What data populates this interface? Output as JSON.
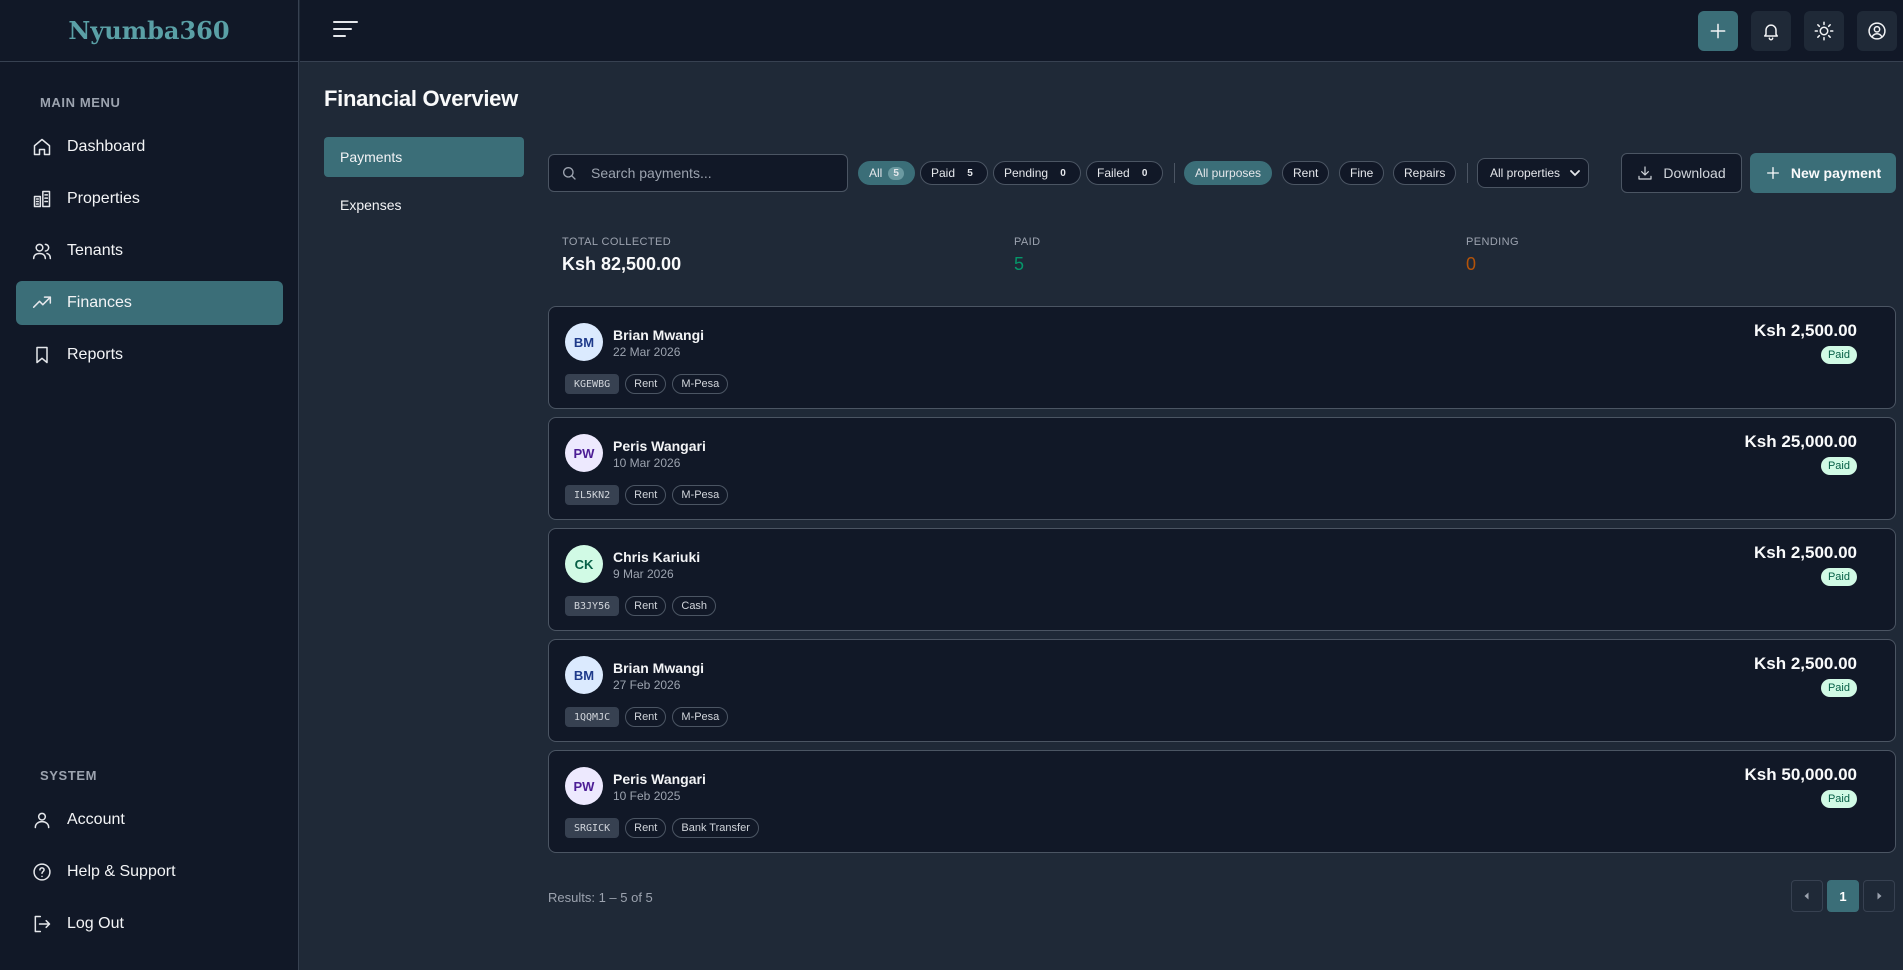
{
  "app": {
    "logo": "Nyumba360"
  },
  "sidebar": {
    "main_menu_label": "MAIN MENU",
    "main_items": [
      {
        "label": "Dashboard",
        "icon": "home-icon"
      },
      {
        "label": "Properties",
        "icon": "building-icon"
      },
      {
        "label": "Tenants",
        "icon": "users-icon"
      },
      {
        "label": "Finances",
        "icon": "trending-up-icon",
        "active": true
      },
      {
        "label": "Reports",
        "icon": "bookmark-icon"
      }
    ],
    "system_label": "SYSTEM",
    "system_items": [
      {
        "label": "Account",
        "icon": "user-icon"
      },
      {
        "label": "Help & Support",
        "icon": "help-circle-icon"
      },
      {
        "label": "Log Out",
        "icon": "logout-icon"
      }
    ]
  },
  "topbar": {
    "icons": [
      "menu-icon",
      "plus-icon",
      "bell-icon",
      "sun-icon",
      "user-circle-icon"
    ]
  },
  "page": {
    "title": "Financial Overview",
    "subnav": [
      {
        "label": "Payments",
        "active": true
      },
      {
        "label": "Expenses",
        "active": false
      }
    ]
  },
  "toolbar": {
    "search_placeholder": "Search payments...",
    "status_filters": [
      {
        "label": "All",
        "count": "5",
        "active": true
      },
      {
        "label": "Paid",
        "count": "5",
        "active": false
      },
      {
        "label": "Pending",
        "count": "0",
        "active": false
      },
      {
        "label": "Failed",
        "count": "0",
        "active": false
      }
    ],
    "purpose_filters": [
      {
        "label": "All purposes",
        "active": true
      },
      {
        "label": "Rent",
        "active": false
      },
      {
        "label": "Fine",
        "active": false
      },
      {
        "label": "Repairs",
        "active": false
      }
    ],
    "property_select": "All properties",
    "download_label": "Download",
    "new_payment_label": "New payment"
  },
  "stats": {
    "total_label": "TOTAL COLLECTED",
    "total_value": "Ksh 82,500.00",
    "paid_label": "PAID",
    "paid_value": "5",
    "pending_label": "PENDING",
    "pending_value": "0",
    "colors": {
      "paid": "#059669",
      "pending": "#b45309"
    }
  },
  "payments": [
    {
      "initials": "BM",
      "name": "Brian Mwangi",
      "date": "22 Mar 2026",
      "code": "KGEWBG",
      "purpose": "Rent",
      "method": "M-Pesa",
      "amount": "Ksh 2,500.00",
      "status": "Paid",
      "avatar_bg": "#dbeafe",
      "avatar_fg": "#1e3a8a"
    },
    {
      "initials": "PW",
      "name": "Peris Wangari",
      "date": "10 Mar 2026",
      "code": "IL5KN2",
      "purpose": "Rent",
      "method": "M-Pesa",
      "amount": "Ksh 25,000.00",
      "status": "Paid",
      "avatar_bg": "#ede9fe",
      "avatar_fg": "#4c1d95"
    },
    {
      "initials": "CK",
      "name": "Chris Kariuki",
      "date": "9 Mar 2026",
      "code": "B3JY56",
      "purpose": "Rent",
      "method": "Cash",
      "amount": "Ksh 2,500.00",
      "status": "Paid",
      "avatar_bg": "#d1fae5",
      "avatar_fg": "#065f46"
    },
    {
      "initials": "BM",
      "name": "Brian Mwangi",
      "date": "27 Feb 2026",
      "code": "1QQMJC",
      "purpose": "Rent",
      "method": "M-Pesa",
      "amount": "Ksh 2,500.00",
      "status": "Paid",
      "avatar_bg": "#dbeafe",
      "avatar_fg": "#1e3a8a"
    },
    {
      "initials": "PW",
      "name": "Peris Wangari",
      "date": "10 Feb 2025",
      "code": "SRGICK",
      "purpose": "Rent",
      "method": "Bank Transfer",
      "amount": "Ksh 50,000.00",
      "status": "Paid",
      "avatar_bg": "#ede9fe",
      "avatar_fg": "#4c1d95"
    }
  ],
  "pagination": {
    "results_text": "Results: 1 – 5 of 5",
    "current_page": "1"
  }
}
